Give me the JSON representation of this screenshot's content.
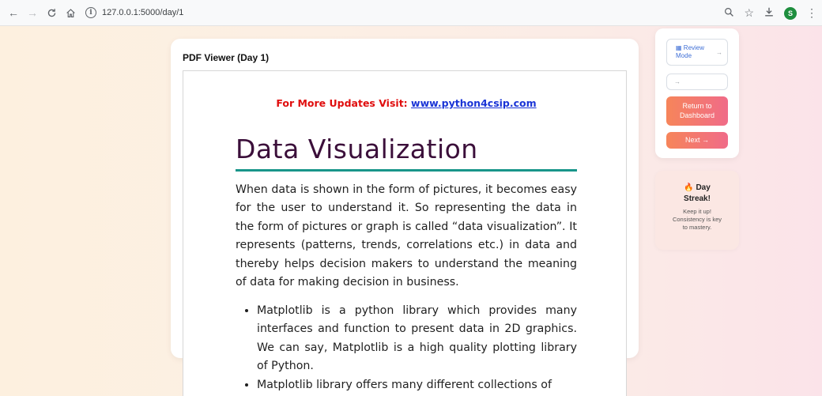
{
  "browser": {
    "back_icon": "←",
    "forward_icon": "→",
    "reload_icon": "C",
    "home_icon": "⌂",
    "info_icon": "i",
    "url": "127.0.0.1:5000/day/1",
    "zoom_icon": "🔍",
    "star_icon": "☆",
    "download_icon": "⤓",
    "profile_initial": "S",
    "menu_icon": "⋮"
  },
  "viewer": {
    "title": "PDF Viewer (Day 1)"
  },
  "document": {
    "updates_label": "For More Updates Visit:",
    "updates_link": "www.python4csip.com",
    "heading": "Data Visualization",
    "paragraph": "When data is shown in the form of pictures, it becomes easy for the user to understand it. So representing the data in the form of pictures or graph is called “data visualization”. It represents (patterns, trends, correlations etc.) in data and thereby helps decision makers to understand the meaning of data for making decision in business.",
    "bullets": [
      "Matplotlib is a python library which provides many interfaces and function to present data in 2D graphics. We can say, Matplotlib is a high quality plotting library of Python.",
      "Matplotlib library offers many different collections of"
    ]
  },
  "sidebar": {
    "review_icon": "▦",
    "review_label_line1": "Review",
    "review_label_line2": "Mode",
    "review_arrow": "→",
    "blank_arrow": "→",
    "return_line1": "Return to",
    "return_line2": "Dashboard",
    "next_label": "Next →"
  },
  "streak": {
    "flame_icon": "🔥",
    "title_line1": "Day",
    "title_line2": "Streak!",
    "text_line1": "Keep it up!",
    "text_line2": "Consistency is key",
    "text_line3": "to mastery."
  }
}
